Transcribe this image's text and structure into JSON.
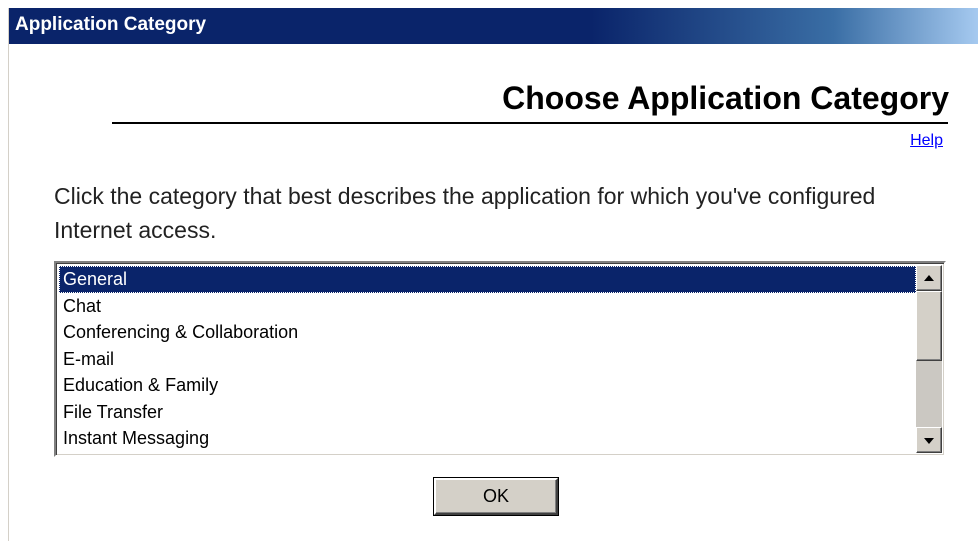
{
  "window": {
    "title": "Application Category"
  },
  "page": {
    "heading": "Choose Application Category",
    "help_label": "Help",
    "instruction": "Click the category that best describes the application for which you've configured Internet access."
  },
  "category_list": {
    "items": [
      "General",
      "Chat",
      "Conferencing & Collaboration",
      "E-mail",
      "Education & Family",
      "File Transfer",
      "Instant Messaging"
    ],
    "selected": "General"
  },
  "ok_label": "OK",
  "colors": {
    "title_bar": "#0a246a",
    "selection": "#0a246a",
    "link": "#0000ff",
    "button_face": "#d4d0c8"
  }
}
